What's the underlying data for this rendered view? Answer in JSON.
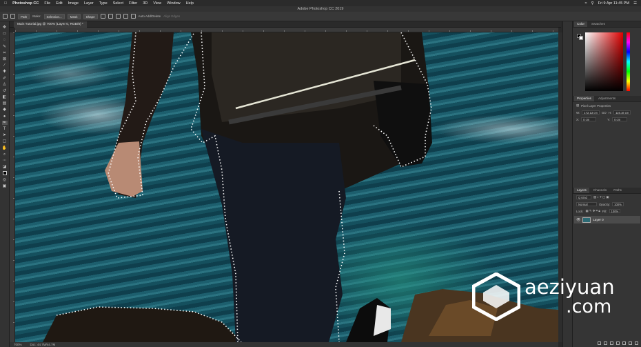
{
  "menubar": {
    "apple": "",
    "app_name": "Photoshop CC",
    "items": [
      "File",
      "Edit",
      "Image",
      "Layer",
      "Type",
      "Select",
      "Filter",
      "3D",
      "View",
      "Window",
      "Help"
    ],
    "clock": "Fri 9 Apr  11:45 PM"
  },
  "window_title": "Adobe Photoshop CC 2019",
  "options": {
    "mode": "Path",
    "make_label": "Make:",
    "selection_btn": "Selection...",
    "mask_btn": "Mask",
    "shape_btn": "Shape",
    "auto_add_delete": "Auto Add/Delete",
    "align_edges": "Align Edges"
  },
  "document": {
    "tab_label": "Main Tutorial.jpg @ 700% (Layer 0, RGB/8) *"
  },
  "status": {
    "zoom": "700%",
    "doc_info": "Doc: 44.7M/44.7M"
  },
  "panels": {
    "color_tabs": [
      "Color",
      "Swatches"
    ],
    "properties_tabs": [
      "Properties",
      "Adjustments"
    ],
    "properties_title": "Pixel Layer Properties",
    "w": "W:",
    "w_val": "172.13 cm",
    "go": "GO",
    "h": "H:",
    "h_val": "116.16 cm",
    "x": "X:",
    "x_val": "0 cm",
    "y": "Y:",
    "y_val": "0 cm",
    "layers_tabs": [
      "Layers",
      "Channels",
      "Paths"
    ],
    "kind": "Q Kind",
    "blend": "Normal",
    "opacity_label": "Opacity:",
    "opacity": "100%",
    "lock_label": "Lock:",
    "fill_label": "Fill:",
    "fill": "100%",
    "layer_name": "Layer 0"
  },
  "watermark": {
    "line1": "aeziyuan",
    "line2": ".com"
  }
}
